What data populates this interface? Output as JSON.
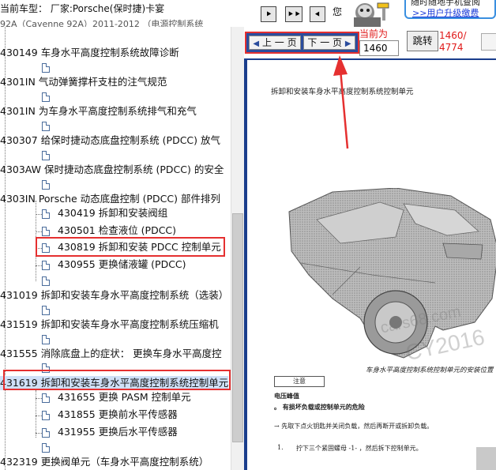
{
  "header": {
    "car_model": "当前车型： 厂家:Porsche(保时捷)卡宴",
    "car_model_sub": "92A（Cayenne 92A）2011-2012 （电源控制系统",
    "nav_buttons": [
      "⯈",
      "⯈⯈",
      "⯇"
    ],
    "you_label": "您",
    "ad_top": "随时随地手机查阅",
    "ad_link": ">>用户升级缴费"
  },
  "tree": {
    "items": [
      {
        "label": "430149 车身水平高度控制系统故障诊断"
      },
      {
        "label": "4301IN 气动弹簧撑杆支柱的注气规范"
      },
      {
        "label": "4301IN 为车身水平高度控制系统排气和充气"
      },
      {
        "label": "430307 给保时捷动态底盘控制系统 (PDCC) 放气"
      },
      {
        "label": "4303AW 保时捷动态底盘控制系统 (PDCC) 的安全"
      },
      {
        "label": "4303IN Porsche 动态底盘控制 (PDCC) 部件排列"
      },
      {
        "label": "430419 拆卸和安装阀组"
      },
      {
        "label": "430501 检查液位 (PDCC)"
      },
      {
        "label": "430819 拆卸和安装 PDCC 控制单元"
      },
      {
        "label": "430955 更换储液罐 (PDCC)"
      },
      {
        "label": "431019 拆卸和安装车身水平高度控制系统（选装）"
      },
      {
        "label": "431519 拆卸和安装车身水平高度控制系统压缩机"
      },
      {
        "label": "431555 消除底盘上的症状： 更换车身水平高度控"
      },
      {
        "label": "431619 拆卸和安装车身水平高度控制系统控制单元"
      },
      {
        "label": "431655 更换 PASM 控制单元"
      },
      {
        "label": "431855 更换前水平传感器"
      },
      {
        "label": "431955 更换后水平传感器"
      },
      {
        "label": "432319 更换阀单元（车身水平高度控制系统）"
      }
    ]
  },
  "viewer": {
    "prev_label": "上 一 页",
    "next_label": "下 一 页",
    "current_label": "当前为",
    "current_page": "1460",
    "jump_label": "跳转",
    "page_position": "1460/",
    "page_total": "4774"
  },
  "document": {
    "heading": "拆卸和安装车身水平高度控制系统控制单元",
    "watermark_1": "cars68.com",
    "watermark_2": "CY2016",
    "caption": "车身水平高度控制系统控制单元的安装位置",
    "note_label": "注意",
    "warning_title": "电压峰值",
    "warning_item": "。 有损坏负载或控制单元的危险",
    "arrow_item": "→ 先取下点火钥匙并关闭负载，然后再断开或拆卸负载。",
    "step_number": "1.",
    "step_text": "拧下三个紧固螺母 -1- ，然后拆下控制单元。"
  }
}
